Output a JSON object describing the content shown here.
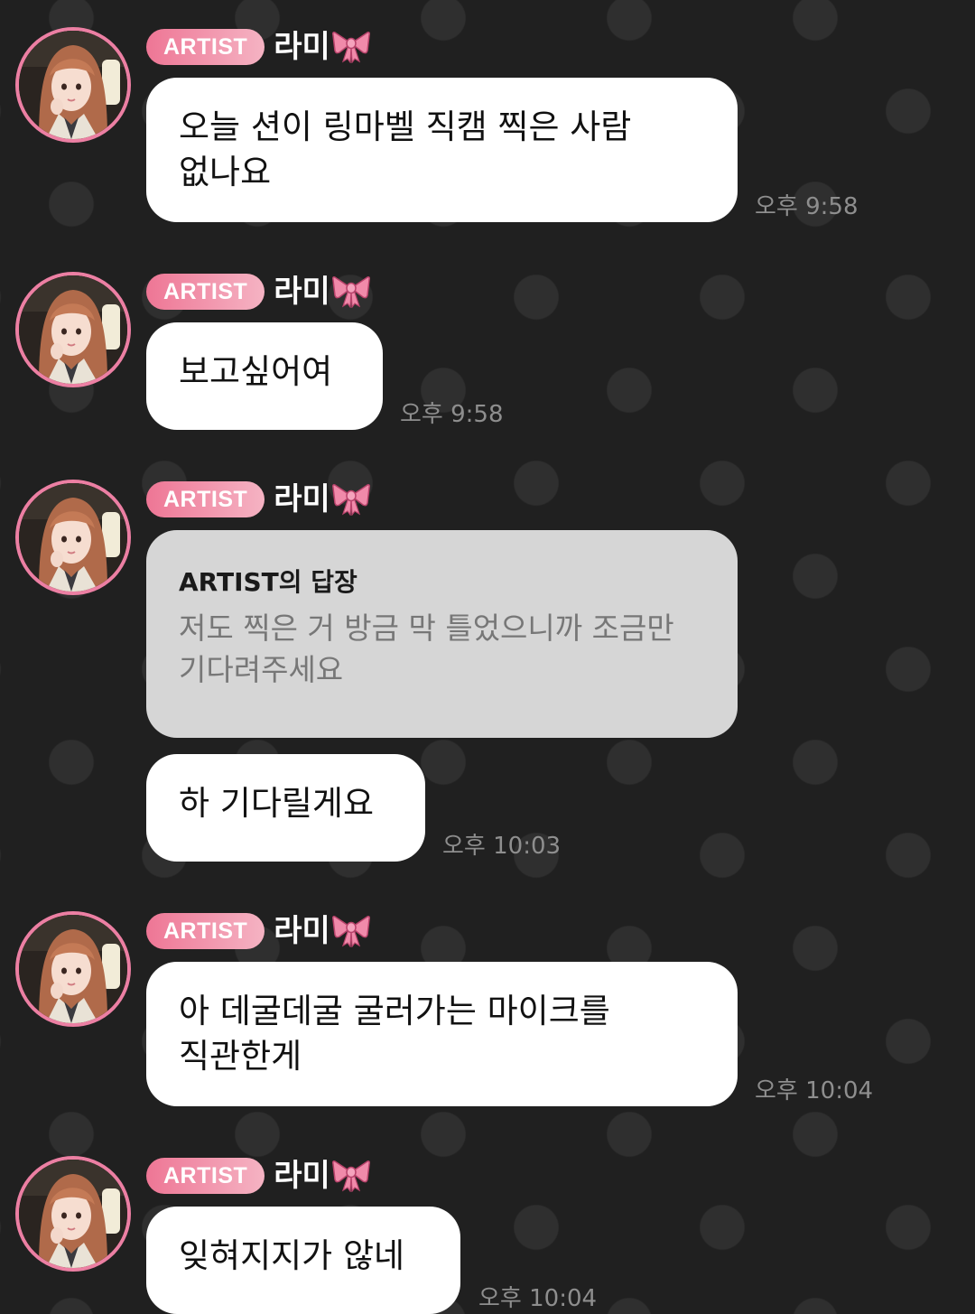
{
  "colors": {
    "background": "#202020",
    "bubble": "#ffffff",
    "reply_bubble": "#d6d6d6",
    "badge_accent": "#ee7695",
    "timestamp": "#8e8e8e"
  },
  "sender": {
    "badge": "ARTIST",
    "name": "라미",
    "name_icon": "ribbon-bow-icon"
  },
  "messages": [
    {
      "text": "오늘 션이 링마벨 직캠 찍은 사람\n없나요",
      "time": "오후 9:58"
    },
    {
      "text": "보고싶어여",
      "time": "오후 9:58"
    },
    {
      "reply": {
        "header": "ARTIST의 답장",
        "body": "저도 찍은 거 방금 막 틀었으니까 조금만\n기다려주세요"
      },
      "text": "하 기다릴게요",
      "time": "오후 10:03"
    },
    {
      "text": "아 데굴데굴 굴러가는 마이크를\n직관한게",
      "time": "오후 10:04"
    },
    {
      "text": "잊혀지지가 않네",
      "time": "오후 10:04"
    }
  ]
}
